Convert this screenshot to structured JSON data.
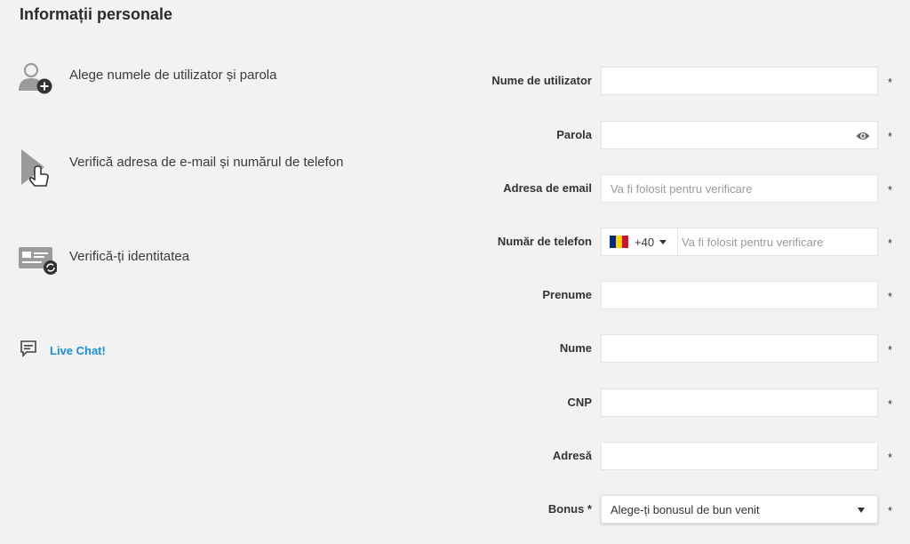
{
  "page": {
    "title": "Informații personale"
  },
  "steps": [
    {
      "icon": "user-add-icon",
      "label": "Alege numele de utilizator și parola"
    },
    {
      "icon": "tap-verify-icon",
      "label": "Verifică adresa de e-mail și numărul de telefon"
    },
    {
      "icon": "id-card-refresh-icon",
      "label": "Verifică-ți identitatea"
    }
  ],
  "chat": {
    "icon": "chat-icon",
    "label": "Live Chat!"
  },
  "form": {
    "username": {
      "label": "Nume de utilizator",
      "value": "",
      "required": "*"
    },
    "password": {
      "label": "Parola",
      "value": "",
      "required": "*",
      "icon": "eye-icon"
    },
    "email": {
      "label": "Adresa de email",
      "placeholder": "Va fi folosit pentru verificare",
      "required": "*"
    },
    "phone": {
      "label": "Număr de telefon",
      "country_code": "+40",
      "flag_colors": [
        "#002b7f",
        "#fcd116",
        "#ce1126"
      ],
      "placeholder": "Va fi folosit pentru verificare",
      "required": "*"
    },
    "first_name": {
      "label": "Prenume",
      "value": "",
      "required": "*"
    },
    "last_name": {
      "label": "Nume",
      "value": "",
      "required": "*"
    },
    "cnp": {
      "label": "CNP",
      "value": "",
      "required": "*"
    },
    "address": {
      "label": "Adresă",
      "value": "",
      "required": "*"
    },
    "bonus": {
      "label": "Bonus *",
      "selected": "Alege-ți bonusul de bun venit",
      "required": "*"
    }
  },
  "colors": {
    "background": "#f2f2f2",
    "link": "#1a8fd6",
    "icon": "#9b9b9b",
    "icon_dark": "#333333"
  }
}
